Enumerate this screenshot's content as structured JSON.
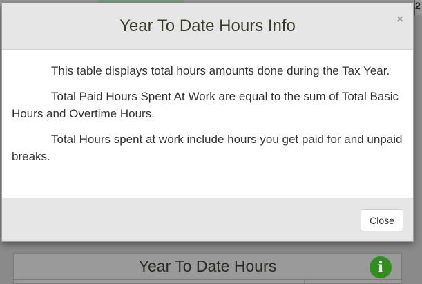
{
  "modal": {
    "title": "Year To Date Hours Info",
    "close_icon": "×",
    "paragraphs": [
      "This table displays total hours amounts done during the Tax Year.",
      "Total Paid Hours Spent At Work are equal to the sum of Total Basic Hours and Overtime Hours.",
      "Total Hours spent at work include hours you get paid for and unpaid breaks."
    ],
    "close_button_label": "Close"
  },
  "background": {
    "panel_title": "Year To Date Hours",
    "info_icon": "i",
    "corner_text": "2"
  },
  "colors": {
    "info_icon": "#2f8f1c",
    "header_bg": "#e6e6e6",
    "overlay": "#8a8a8a"
  }
}
